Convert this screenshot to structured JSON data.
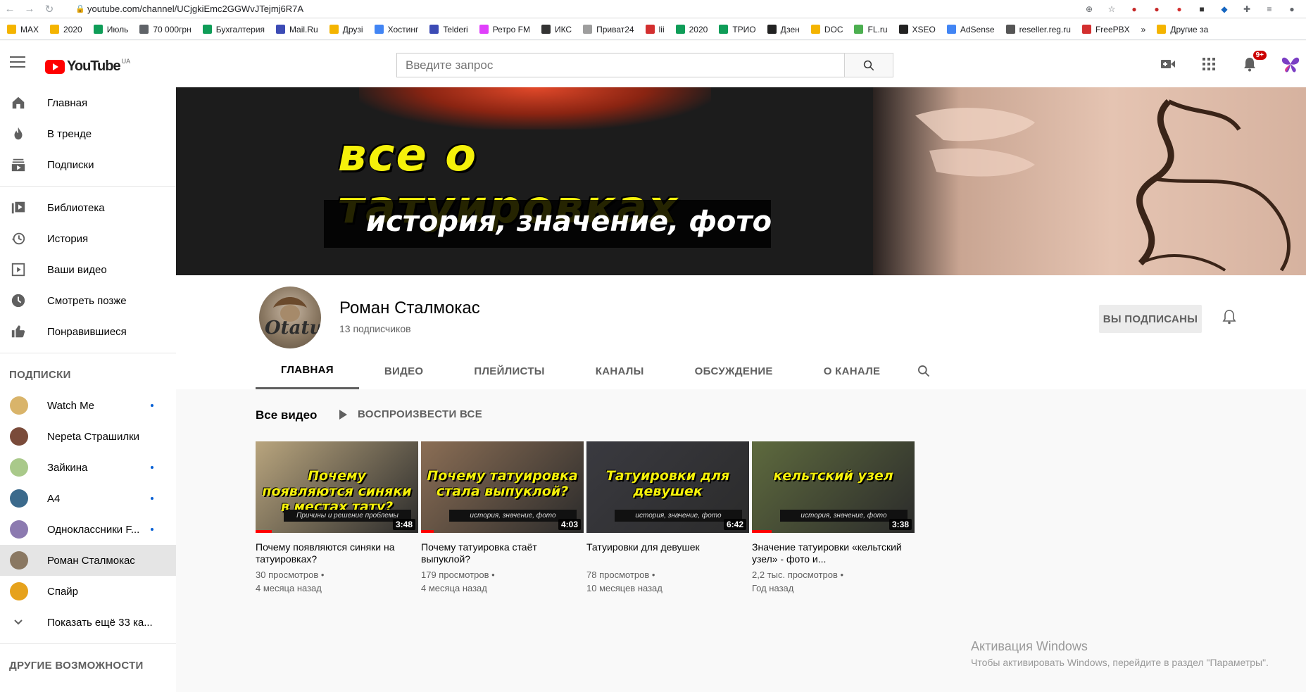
{
  "browser": {
    "url": "youtube.com/channel/UCjgkiEmc2GGWvJTejmj6R7A",
    "bookmarks": [
      "MAX",
      "2020",
      "Июль",
      "70 000грн",
      "Бухгалтерия",
      "Mail.Ru",
      "Друзі",
      "Хостинг",
      "Telderi",
      "Ретро FM",
      "ИКС",
      "Приват24",
      "lii",
      "2020",
      "ТРИО",
      "Дзен",
      "DOC",
      "FL.ru",
      "XSEO",
      "AdSense",
      "reseller.reg.ru",
      "FreePBX",
      "»",
      "Другие за"
    ]
  },
  "header": {
    "logo": "YouTube",
    "country": "UA",
    "search_placeholder": "Введите запрос",
    "notifications_badge": "9+"
  },
  "sidebar": {
    "main": [
      {
        "label": "Главная",
        "icon": "home-icon"
      },
      {
        "label": "В тренде",
        "icon": "trending-icon"
      },
      {
        "label": "Подписки",
        "icon": "subscriptions-icon"
      }
    ],
    "library": [
      {
        "label": "Библиотека",
        "icon": "library-icon"
      },
      {
        "label": "История",
        "icon": "history-icon"
      },
      {
        "label": "Ваши видео",
        "icon": "your-videos-icon"
      },
      {
        "label": "Смотреть позже",
        "icon": "watch-later-icon"
      },
      {
        "label": "Понравившиеся",
        "icon": "liked-icon"
      }
    ],
    "subscriptions_title": "ПОДПИСКИ",
    "subscriptions": [
      {
        "label": "Watch Me",
        "color": "#d9b46a",
        "dot": true
      },
      {
        "label": "Nepeta Страшилки",
        "color": "#7a4b3a",
        "dot": false
      },
      {
        "label": "Зайкина",
        "color": "#a9c98a",
        "dot": true
      },
      {
        "label": "A4",
        "color": "#3b6a8c",
        "dot": true
      },
      {
        "label": "Одноклассники F...",
        "color": "#8c7ab0",
        "dot": true
      },
      {
        "label": "Роман Сталмокас",
        "color": "#8a7862",
        "dot": false,
        "active": true
      },
      {
        "label": "Спайр",
        "color": "#e6a21c",
        "dot": false
      }
    ],
    "show_more": "Показать ещё 33 ка...",
    "more_title": "ДРУГИЕ ВОЗМОЖНОСТИ"
  },
  "banner": {
    "title": "все о татуировках",
    "subtitle": "история, значение, фото"
  },
  "channel": {
    "avatar_text": "Otatu",
    "name": "Роман Сталмокас",
    "subscribers": "13 подписчиков",
    "subscribe_label": "ВЫ ПОДПИСАНЫ",
    "tabs": [
      "ГЛАВНАЯ",
      "ВИДЕО",
      "ПЛЕЙЛИСТЫ",
      "КАНАЛЫ",
      "ОБСУЖДЕНИЕ",
      "О КАНАЛЕ"
    ]
  },
  "section": {
    "title": "Все видео",
    "play_all": "ВОСПРОИЗВЕСТИ ВСЕ"
  },
  "videos": [
    {
      "thumb_text": "Почему появляются синяки в местах тату?",
      "thumb_sub": "Причины и решение проблемы",
      "duration": "3:48",
      "title": "Почему появляются синяки на татуировках?",
      "views": "30 просмотров",
      "age": "4 месяца назад",
      "bg": "#b9a57e",
      "progress": 0.1
    },
    {
      "thumb_text": "Почему татуировка стала выпуклой?",
      "thumb_sub": "история, значение, фото",
      "duration": "4:03",
      "title": "Почему татуировка стаёт выпуклой?",
      "views": "179 просмотров",
      "age": "4 месяца назад",
      "bg": "#8b6e55",
      "progress": 0.08
    },
    {
      "thumb_text": "Татуировки для девушек",
      "thumb_sub": "история, значение, фото",
      "duration": "6:42",
      "title": "Татуировки для девушек",
      "views": "78 просмотров",
      "age": "10 месяцев назад",
      "bg": "#3a3a40",
      "progress": 0
    },
    {
      "thumb_text": "кельтский узел",
      "thumb_sub": "история, значение, фото",
      "duration": "3:38",
      "title": "Значение татуировки «кельтский узел» - фото и...",
      "views": "2,2 тыс. просмотров",
      "age": "Год назад",
      "bg": "#5e6a3e",
      "progress": 0.12
    }
  ],
  "watermark": {
    "line1": "Активация Windows",
    "line2": "Чтобы активировать Windows, перейдите в раздел \"Параметры\"."
  }
}
